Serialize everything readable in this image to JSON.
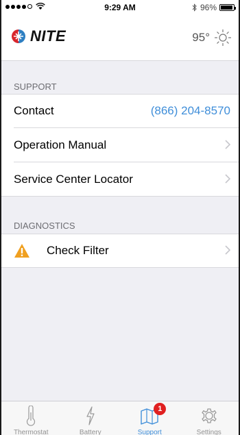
{
  "status_bar": {
    "wifi": "ᯤ",
    "time": "9:29 AM",
    "bluetooth": "✱",
    "battery_percent": "96%",
    "battery_level": 0.96
  },
  "nav": {
    "logo_text": "NITE",
    "temperature": "95°"
  },
  "sections": {
    "support": {
      "header": "SUPPORT",
      "contact_label": "Contact",
      "contact_phone": "(866) 204-8570",
      "manual_label": "Operation Manual",
      "locator_label": "Service Center Locator"
    },
    "diagnostics": {
      "header": "DIAGNOSTICS",
      "check_filter_label": "Check Filter"
    }
  },
  "tabs": {
    "thermostat": "Thermostat",
    "battery": "Battery",
    "support": "Support",
    "support_badge": "1",
    "settings": "Settings"
  },
  "colors": {
    "accent": "#3f8ed9",
    "warning": "#f0a020",
    "badge": "#e02020"
  },
  "icons": [
    "thermometer-icon",
    "lightning-icon",
    "map-icon",
    "gear-icon",
    "sun-icon",
    "warning-icon",
    "chevron-right-icon",
    "nite-logo-icon"
  ]
}
